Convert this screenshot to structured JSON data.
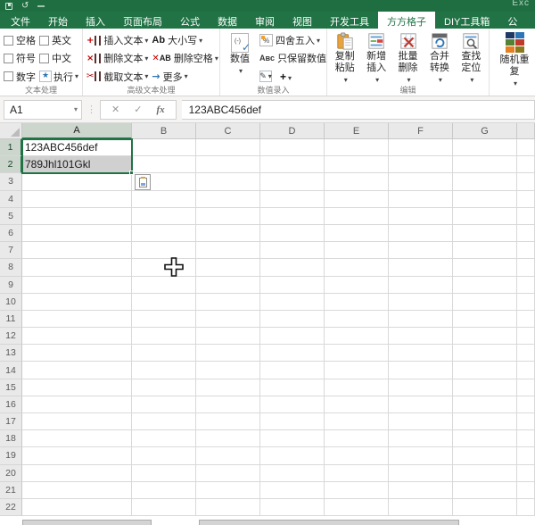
{
  "title_bar": {
    "window_title_fragment": "Exc",
    "quick_access": [
      "save-icon",
      "undo-icon"
    ]
  },
  "ribbon_tabs": {
    "items": [
      {
        "label": "文件",
        "active": false
      },
      {
        "label": "开始",
        "active": false
      },
      {
        "label": "插入",
        "active": false
      },
      {
        "label": "页面布局",
        "active": false
      },
      {
        "label": "公式",
        "active": false
      },
      {
        "label": "数据",
        "active": false
      },
      {
        "label": "审阅",
        "active": false
      },
      {
        "label": "视图",
        "active": false
      },
      {
        "label": "开发工具",
        "active": false
      },
      {
        "label": "方方格子",
        "active": true
      },
      {
        "label": "DIY工具箱",
        "active": false
      },
      {
        "label": "公",
        "active": false,
        "partial": true
      }
    ]
  },
  "ribbon": {
    "groups": {
      "text_process": {
        "label": "文本处理",
        "checkboxes": [
          "空格",
          "英文",
          "符号",
          "中文",
          "数字"
        ],
        "execute": "执行"
      },
      "adv_text": {
        "label": "高级文本处理",
        "insert_text": "插入文本",
        "delete_text": "删除文本",
        "cut_text": "截取文本",
        "case_prefix": "Ab",
        "case": "大小写",
        "strip_prefix": "AB",
        "strip_spaces": "删除空格",
        "more": "更多"
      },
      "numeric_entry": {
        "label": "数值录入",
        "numeric": "数值",
        "round": "四舍五入",
        "keep_prefix": "Aʙᴄ",
        "keep_numbers": "只保留数值"
      },
      "edit": {
        "label": "编辑",
        "copy_paste": "复制粘贴",
        "insert_new": "新增插入",
        "batch_delete": "批量删除",
        "merge_convert": "合并转换",
        "find_locate": "查找定位"
      },
      "random": {
        "random_repeat": "随机重复"
      }
    }
  },
  "formula_bar": {
    "name_box": "A1",
    "cancel_glyph": "✕",
    "enter_glyph": "✓",
    "fx_glyph": "fx",
    "formula": "123ABC456def"
  },
  "sheet": {
    "column_headers": [
      "A",
      "B",
      "C",
      "D",
      "E",
      "F",
      "G"
    ],
    "visible_row_count": 22,
    "cells": [
      {
        "ref": "A1",
        "value": "123ABC456def"
      },
      {
        "ref": "A2",
        "value": "789Jhl101Gkl"
      }
    ],
    "selection": {
      "range": "A1:A2",
      "active_cell": "A1"
    },
    "pointer": "cell-cross-cursor"
  },
  "icons": {
    "undo": "↺",
    "star": "★",
    "scissor": "✂",
    "pencil": "✎",
    "plus": "+",
    "more_arrow": "→",
    "redx": "✕"
  },
  "colors": {
    "accent_green": "#217346",
    "title_bar_green": "#1f6e42",
    "selection_fill": "#d0d0d0",
    "selected_header": "#ccd6cc"
  }
}
